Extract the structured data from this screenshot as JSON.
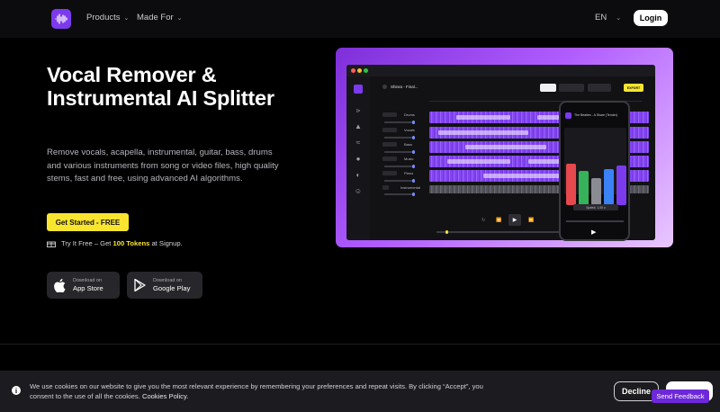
{
  "nav": {
    "products": "Products",
    "made_for": "Made For",
    "language": "EN",
    "login": "Login"
  },
  "hero": {
    "title": "Vocal Remover & Instrumental AI Splitter",
    "description": "Remove vocals, acapella, instrumental, guitar, bass, drums and various instruments from song or video files, high quality stems, fast and free, using advanced AI algorithms.",
    "cta": "Get Started - FREE",
    "try_prefix": "Try It Free – Get ",
    "try_tokens": "100 Tokens",
    "try_suffix": " at Signup."
  },
  "stores": {
    "apple_sub": "Download on",
    "apple_main": "App Store",
    "google_sub": "Download on",
    "google_main": "Google Play"
  },
  "mockup": {
    "file_name": "Shinra - Final...",
    "export_label": "EXPORT",
    "tracks": [
      "Drums",
      "Vocals",
      "Bass",
      "Music",
      "Piano",
      "Instrumental"
    ],
    "phone_song": "The Beatles - A Share (Tender)",
    "phone_speed": "Speed: 1.00 x"
  },
  "cookie": {
    "text": "We use cookies on our website to give you the most relevant experience by remembering your preferences and repeat visits. By clicking “Accept”, you consent to the use of all the cookies.",
    "policy_link": "Cookies Policy.",
    "decline": "Decline",
    "feedback": "Send Feedback"
  },
  "colors": {
    "accent_purple": "#7c3aed",
    "cta_yellow": "#f9e52f"
  }
}
